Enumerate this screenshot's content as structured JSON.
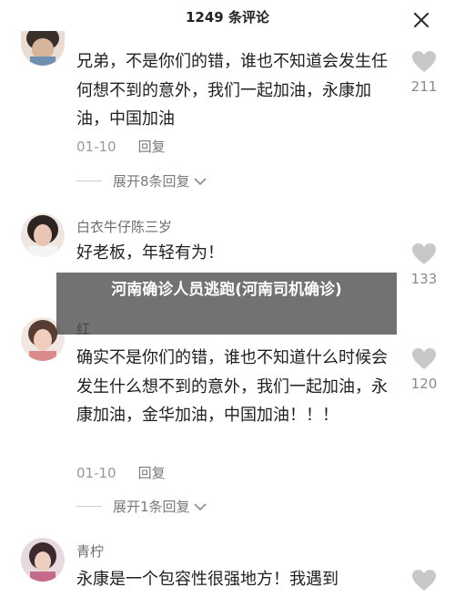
{
  "header": {
    "title": "1249 条评论",
    "close_icon": "close-icon"
  },
  "comments": [
    {
      "username": "",
      "text": "兄弟，不是你们的错，谁也不知道会发生任何想不到的意外，我们一起加油，永康加油，中国加油",
      "date": "01-10",
      "reply_label": "回复",
      "expand_label": "展开8条回复",
      "likes": "211"
    },
    {
      "username": "白衣牛仔陈三岁",
      "text": "好老板，年轻有为！",
      "likes": "133"
    },
    {
      "username": "红",
      "text": "确实不是你们的错，谁也不知道什么时候会发生什么想不到的意外，我们一起加油，永康加油，金华加油，中国加油！！！",
      "date": "01-10",
      "reply_label": "回复",
      "expand_label": "展开1条回复",
      "likes": "120"
    },
    {
      "username": "青柠",
      "text": "永康是一个包容性很强地方！我遇到"
    }
  ],
  "overlay": {
    "text": "河南确诊人员逃跑(河南司机确诊)"
  },
  "colors": {
    "heart": "#c8c8c8",
    "overlay_bg": "#3c3c3c"
  }
}
